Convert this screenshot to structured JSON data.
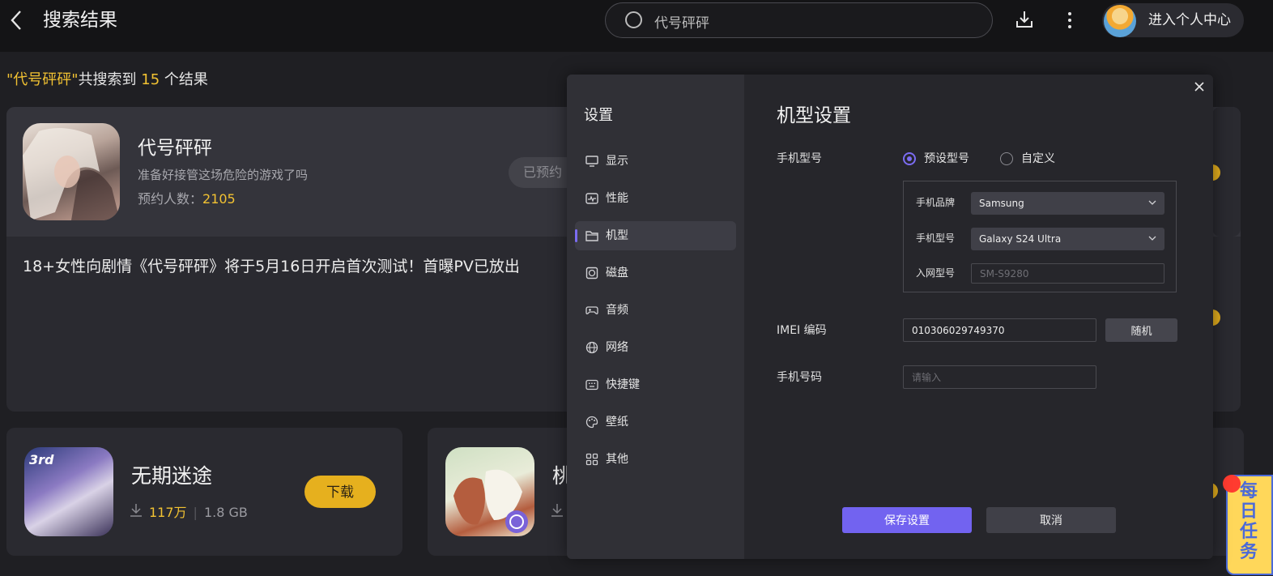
{
  "header": {
    "title": "搜索结果",
    "search_value": "代号砰砰",
    "user_label": "进入个人中心"
  },
  "summary": {
    "query": "\"代号砰砰\"",
    "text1": "共搜索到 ",
    "count": "15",
    "text2": " 个结果"
  },
  "main_card": {
    "name": "代号砰砰",
    "desc": "准备好接管这场危险的游戏了吗",
    "count_label": "预约人数：",
    "count_value": "2105",
    "reserved_label": "已预约",
    "news": "18+女性向剧情《代号砰砰》将于5月16日开启首次测试！首曝PV已放出"
  },
  "cards": [
    {
      "name": "无期迷途",
      "icon_badge": "3rd",
      "downloads": "117万",
      "size": "1.8 GB",
      "button": "下载"
    },
    {
      "name": "桃",
      "downloads": ""
    }
  ],
  "daily_task": "每日任务",
  "dialog": {
    "side_title": "设置",
    "nav": [
      {
        "label": "显示",
        "icon": "monitor-icon"
      },
      {
        "label": "性能",
        "icon": "performance-icon"
      },
      {
        "label": "机型",
        "icon": "folder-icon",
        "active": true
      },
      {
        "label": "磁盘",
        "icon": "disk-icon"
      },
      {
        "label": "音频",
        "icon": "gamepad-icon"
      },
      {
        "label": "网络",
        "icon": "globe-icon"
      },
      {
        "label": "快捷键",
        "icon": "keyboard-icon"
      },
      {
        "label": "壁纸",
        "icon": "palette-icon"
      },
      {
        "label": "其他",
        "icon": "grid-icon"
      }
    ],
    "title": "机型设置",
    "phone_model_label": "手机型号",
    "radio_preset": "预设型号",
    "radio_custom": "自定义",
    "radio_selected": "预设型号",
    "brand_label": "手机品牌",
    "brand_value": "Samsung",
    "model_label": "手机型号",
    "model_value": "Galaxy S24 Ultra",
    "network_model_label": "入网型号",
    "network_model_placeholder": "SM-S9280",
    "imei_label": "IMEI 编码",
    "imei_value": "010306029749370",
    "random_button": "随机",
    "phone_number_label": "手机号码",
    "phone_number_placeholder": "请输入",
    "save_button": "保存设置",
    "cancel_button": "取消",
    "close_icon": "close-icon"
  }
}
